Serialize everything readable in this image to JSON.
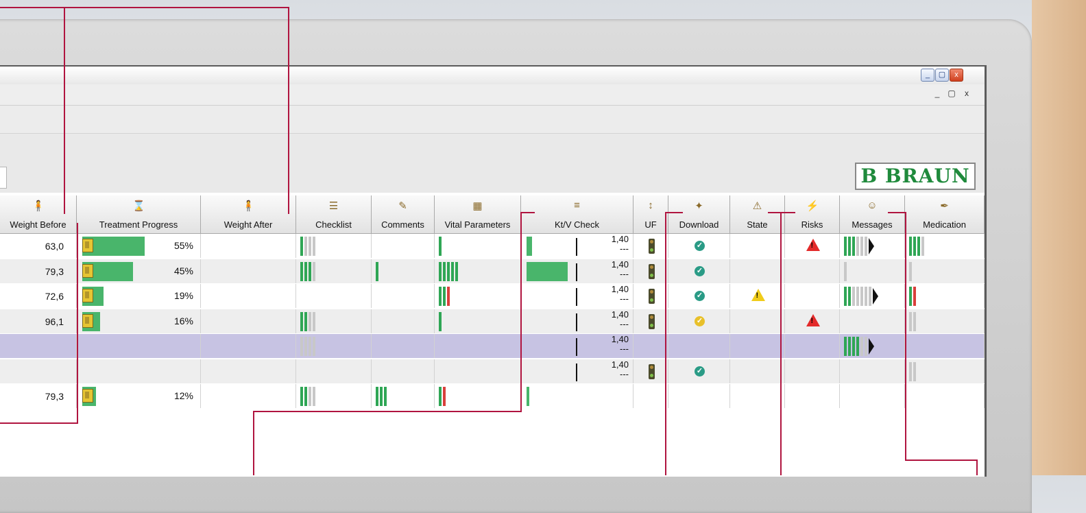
{
  "window": {
    "buttons": [
      "_",
      "▢",
      "x"
    ],
    "mdi_buttons": [
      "_",
      "▢",
      "x"
    ]
  },
  "logo": {
    "text": "B BRAUN",
    "color": "#1f8a3c"
  },
  "columns": [
    {
      "key": "weight_before",
      "label": "Weight Before",
      "icon": "person-icon"
    },
    {
      "key": "treatment_progress",
      "label": "Treatment Progress",
      "icon": "hourglass-icon"
    },
    {
      "key": "weight_after",
      "label": "Weight After",
      "icon": "person-icon"
    },
    {
      "key": "checklist",
      "label": "Checklist",
      "icon": "checklist-icon"
    },
    {
      "key": "comments",
      "label": "Comments",
      "icon": "comment-edit-icon"
    },
    {
      "key": "vital_parameters",
      "label": "Vital Parameters",
      "icon": "chart-icon"
    },
    {
      "key": "ktv_check",
      "label": "Kt/V Check",
      "icon": "ktv-icon"
    },
    {
      "key": "uf",
      "label": "UF",
      "icon": "uf-icon"
    },
    {
      "key": "download",
      "label": "Download",
      "icon": "wand-icon"
    },
    {
      "key": "state",
      "label": "State",
      "icon": "warning-icon"
    },
    {
      "key": "risks",
      "label": "Risks",
      "icon": "risks-icon"
    },
    {
      "key": "messages",
      "label": "Messages",
      "icon": "people-icon"
    },
    {
      "key": "medication",
      "label": "Medication",
      "icon": "syringe-icon"
    }
  ],
  "rows": [
    {
      "weight_before": "63,0",
      "progress": 0.55,
      "progress_label": "55%",
      "checklist": "1g3l",
      "comments": "",
      "vitals": "1g",
      "ktv_fill": 0.1,
      "ktv": "1,40",
      "ktv_sub": "---",
      "uf": true,
      "download": "ok",
      "state": "",
      "risks": "red",
      "messages": "3g3l",
      "messages_arrow": true,
      "medication": "3g1l",
      "highlight": false
    },
    {
      "weight_before": "79,3",
      "progress": 0.45,
      "progress_label": "45%",
      "checklist": "3g1l",
      "comments": "1g",
      "vitals": "5g",
      "ktv_fill": 0.75,
      "ktv": "1,40",
      "ktv_sub": "---",
      "uf": true,
      "download": "ok",
      "state": "",
      "risks": "",
      "messages": "1l",
      "messages_arrow": false,
      "medication": "1l",
      "highlight": false
    },
    {
      "weight_before": "72,6",
      "progress": 0.19,
      "progress_label": "19%",
      "checklist": "",
      "comments": "",
      "vitals": "2g1r",
      "ktv_fill": 0,
      "ktv": "1,40",
      "ktv_sub": "---",
      "uf": true,
      "download": "ok",
      "state": "yellow",
      "risks": "",
      "messages": "2g5l",
      "messages_arrow": true,
      "medication": "1g1r",
      "highlight": false
    },
    {
      "weight_before": "96,1",
      "progress": 0.16,
      "progress_label": "16%",
      "checklist": "2g2l",
      "comments": "",
      "vitals": "1g",
      "ktv_fill": 0,
      "ktv": "1,40",
      "ktv_sub": "---",
      "uf": true,
      "download": "yellow",
      "state": "",
      "risks": "red",
      "messages": "",
      "messages_arrow": false,
      "medication": "2l",
      "highlight": false
    },
    {
      "weight_before": "",
      "progress": 0,
      "progress_label": "",
      "checklist": "4l",
      "comments": "",
      "vitals": "",
      "ktv_fill": 0,
      "ktv": "1,40",
      "ktv_sub": "---",
      "uf": false,
      "download": "",
      "state": "",
      "risks": "",
      "messages": "4g2l",
      "messages_arrow": true,
      "medication": "",
      "highlight": true
    },
    {
      "weight_before": "",
      "progress": 0,
      "progress_label": "",
      "checklist": "",
      "comments": "",
      "vitals": "",
      "ktv_fill": 0,
      "ktv": "1,40",
      "ktv_sub": "---",
      "uf": true,
      "download": "ok",
      "state": "",
      "risks": "",
      "messages": "",
      "messages_arrow": false,
      "medication": "2l",
      "highlight": false
    },
    {
      "weight_before": "79,3",
      "progress": 0.12,
      "progress_label": "12%",
      "checklist": "2g2l",
      "comments": "3g",
      "vitals": "1g1r",
      "ktv_fill": 0.05,
      "ktv": "",
      "ktv_sub": "",
      "uf": false,
      "download": "",
      "state": "",
      "risks": "",
      "messages": "",
      "messages_arrow": false,
      "medication": "",
      "highlight": false
    }
  ],
  "colors": {
    "row_alt": "#eeeeee",
    "row_highlight": "#c7c3e3",
    "progress": "#49b56b",
    "leader": "#b0143f"
  }
}
